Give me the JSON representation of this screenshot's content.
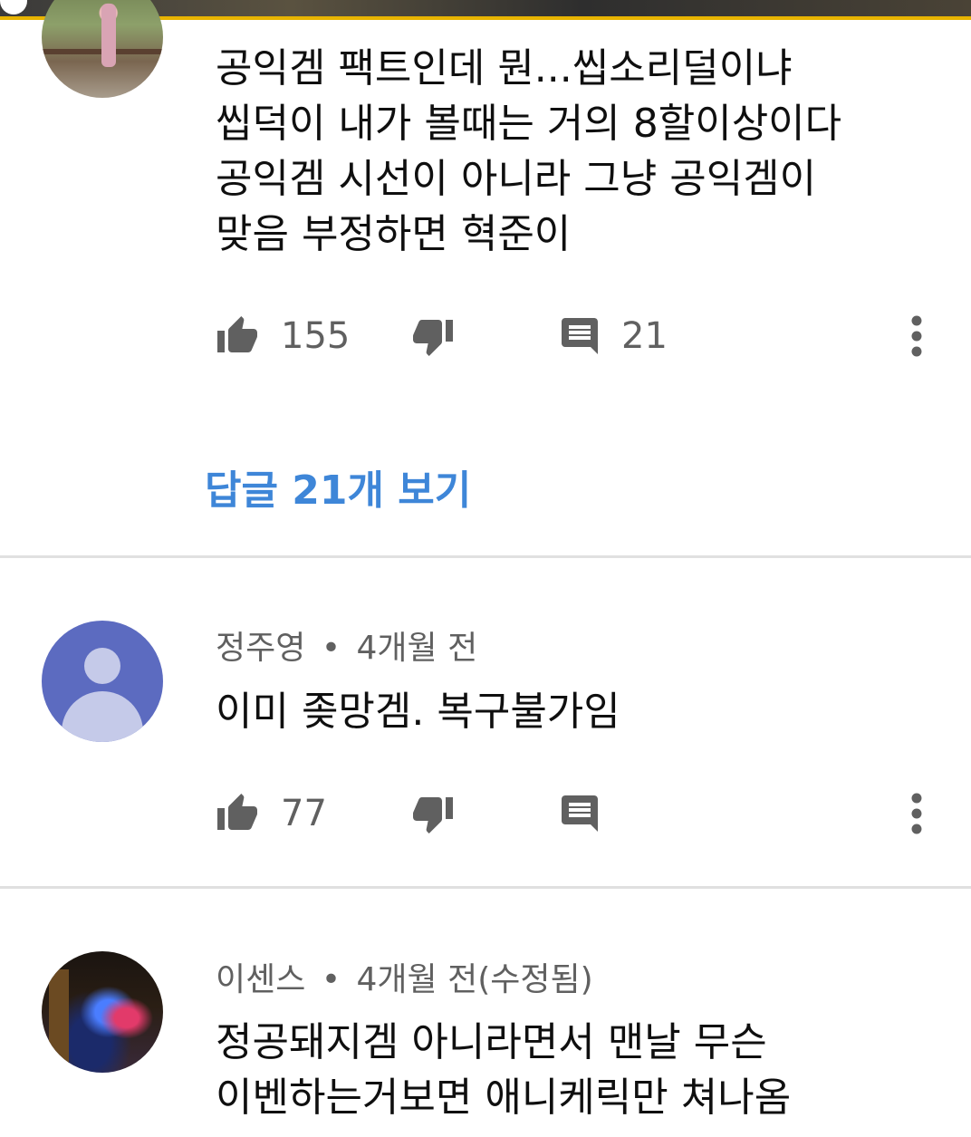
{
  "comments": [
    {
      "author": "",
      "time": "",
      "text_lines": [
        "공익겜 팩트인데 뭔...씹소리덜이냐",
        "씹덕이 내가 볼때는 거의 8할이상이다",
        "공익겜 시선이 아니라 그냥 공익겜이",
        "맞음 부정하면 혁준이"
      ],
      "likes": "155",
      "replies_count": "21",
      "view_replies_label": "답글 21개 보기"
    },
    {
      "author": "정주영",
      "separator": "•",
      "time": "4개월 전",
      "text_lines": [
        "이미 좆망겜. 복구불가임"
      ],
      "likes": "77"
    },
    {
      "author": "이센스",
      "separator": "•",
      "time": "4개월 전(수정됨)",
      "text_lines": [
        "정공돼지겜 아니라면서 맨날 무슨",
        "이벤하는거보면 애니케릭만 쳐나옴"
      ]
    }
  ],
  "icons": {
    "like": "thumb-up-icon",
    "dislike": "thumb-down-icon",
    "reply": "comment-icon",
    "more": "more-vert-icon"
  },
  "colors": {
    "accent_link": "#3e86d8",
    "meta_text": "#606060",
    "avatar_default": "#5c6bc0",
    "video_border": "#e8b400"
  }
}
